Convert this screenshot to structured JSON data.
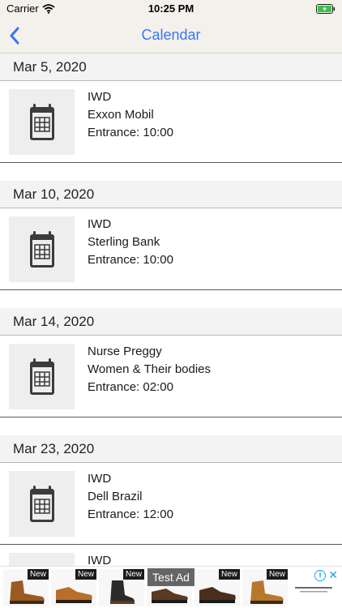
{
  "status_bar": {
    "carrier": "Carrier",
    "time": "10:25 PM",
    "wifi_icon": "wifi-icon",
    "battery_icon": "battery-charging-icon"
  },
  "nav": {
    "title": "Calendar",
    "back_icon": "chevron-left-icon",
    "accent_color": "#3478f6"
  },
  "events": [
    {
      "date": "Mar 5, 2020",
      "title": "IWD",
      "subtitle": "Exxon Mobil",
      "entrance": "Entrance: 10:00",
      "icon": "calendar-icon"
    },
    {
      "date": "Mar 10, 2020",
      "title": "IWD",
      "subtitle": "Sterling Bank",
      "entrance": "Entrance: 10:00",
      "icon": "calendar-icon"
    },
    {
      "date": "Mar 14, 2020",
      "title": "Nurse Preggy",
      "subtitle": "Women & Their bodies",
      "entrance": "Entrance: 02:00",
      "icon": "calendar-icon"
    },
    {
      "date": "Mar 23, 2020",
      "title": "IWD",
      "subtitle": "Dell Brazil",
      "entrance": "Entrance: 12:00",
      "icon": "calendar-icon"
    },
    {
      "date": "",
      "title": "IWD",
      "subtitle": "",
      "entrance": "",
      "icon": "calendar-icon"
    }
  ],
  "ad": {
    "label": "Test Ad",
    "new_badge": "New",
    "info_icon": "info-icon",
    "close_icon": "close-icon",
    "products": [
      "boot",
      "shoe",
      "boot",
      "shoe",
      "shoe",
      "boot"
    ]
  }
}
